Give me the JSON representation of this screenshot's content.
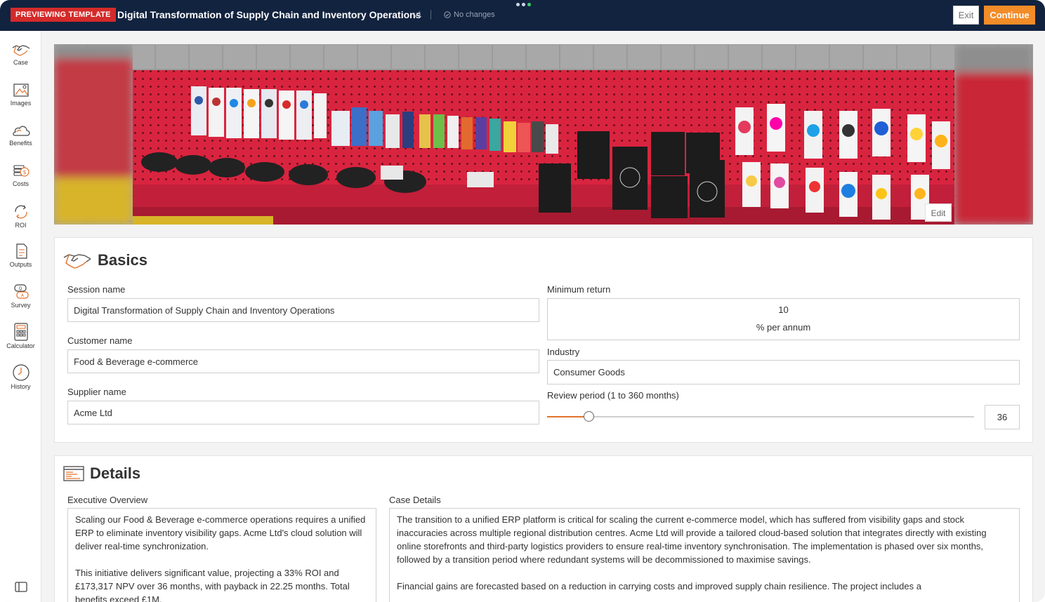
{
  "header": {
    "badge": "PREVIEWING TEMPLATE",
    "title": "Digital Transformation of Supply Chain and Inventory Operations",
    "version": "v1",
    "status": "No changes",
    "exit_label": "Exit",
    "continue_label": "Continue"
  },
  "sidebar": {
    "items": [
      {
        "label": "Case",
        "icon": "handshake-icon"
      },
      {
        "label": "Images",
        "icon": "image-icon"
      },
      {
        "label": "Benefits",
        "icon": "cloud-icon"
      },
      {
        "label": "Costs",
        "icon": "coins-icon"
      },
      {
        "label": "ROI",
        "icon": "refresh-icon"
      },
      {
        "label": "Outputs",
        "icon": "document-icon"
      },
      {
        "label": "Survey",
        "icon": "chat-icon"
      },
      {
        "label": "Calculator",
        "icon": "calculator-icon"
      },
      {
        "label": "History",
        "icon": "clock-icon"
      }
    ]
  },
  "banner": {
    "edit_label": "Edit"
  },
  "basics": {
    "title": "Basics",
    "session_label": "Session name",
    "session_value": "Digital Transformation of Supply Chain and Inventory Operations",
    "customer_label": "Customer name",
    "customer_value": "Food & Beverage e-commerce",
    "supplier_label": "Supplier name",
    "supplier_value": "Acme Ltd",
    "min_return_label": "Minimum return",
    "min_return_value": "10",
    "min_return_unit": "% per annum",
    "industry_label": "Industry",
    "industry_value": "Consumer Goods",
    "review_label": "Review period (1 to 360 months)",
    "review_value": "36",
    "review_min": 1,
    "review_max": 360
  },
  "details": {
    "title": "Details",
    "exec_label": "Executive Overview",
    "exec_text": "Scaling our Food & Beverage e-commerce operations requires a unified ERP to eliminate inventory visibility gaps. Acme Ltd's cloud solution will deliver real-time synchronization.\n\nThis initiative delivers significant value, projecting a 33% ROI and £173,317 NPV over 36 months, with payback in 22.25 months. Total benefits exceed £1M.",
    "case_label": "Case Details",
    "case_text": "The transition to a unified ERP platform is critical for scaling the current e-commerce model, which has suffered from visibility gaps and stock inaccuracies across multiple regional distribution centres. Acme Ltd will provide a tailored cloud-based solution that integrates directly with existing online storefronts and third-party logistics providers to ensure real-time inventory synchronisation. The implementation is phased over six months, followed by a transition period where redundant systems will be decommissioned to maximise savings.\n\nFinancial gains are forecasted based on a reduction in carrying costs and improved supply chain resilience. The project includes a"
  },
  "colors": {
    "accent": "#f28c28",
    "topbar": "#12233f",
    "badge": "#d42a2a"
  }
}
